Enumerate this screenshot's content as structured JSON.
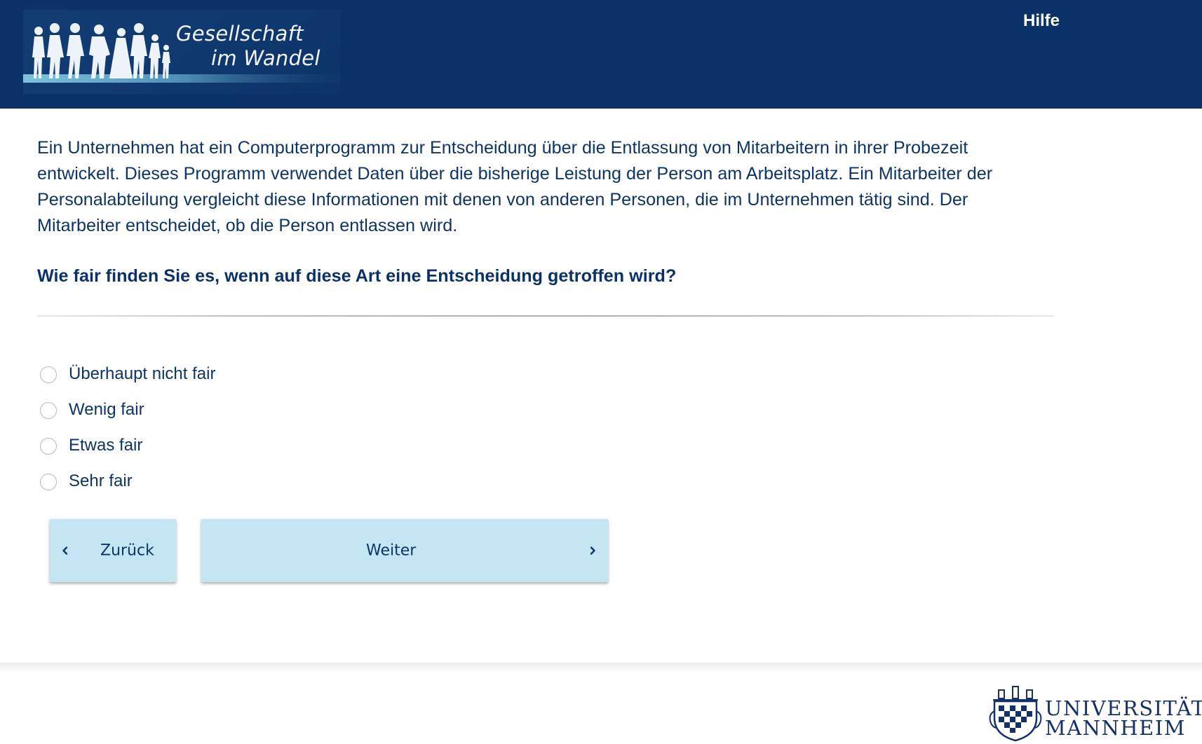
{
  "header": {
    "logo_line1": "Gesellschaft",
    "logo_line2": "im Wandel",
    "help_label": "Hilfe"
  },
  "main": {
    "intro_text": "Ein Unternehmen hat ein Computerprogramm zur Entscheidung über die Entlassung von Mitarbeitern in ihrer Probezeit entwickelt. Dieses Programm verwendet Daten über die bisherige Leistung der Person am Arbeitsplatz. Ein Mitarbeiter der Personalabteilung vergleicht diese Informationen mit denen von anderen Personen, die im Unternehmen tätig sind. Der Mitarbeiter entscheidet, ob die Person entlassen wird.",
    "question": "Wie fair finden Sie es, wenn auf diese Art eine Entscheidung getroffen wird?",
    "options": [
      {
        "label": "Überhaupt nicht fair",
        "selected": false
      },
      {
        "label": "Wenig fair",
        "selected": false
      },
      {
        "label": "Etwas fair",
        "selected": false
      },
      {
        "label": "Sehr fair",
        "selected": false
      }
    ]
  },
  "nav": {
    "back_label": "Zurück",
    "back_icon": "chevron-left-icon",
    "next_label": "Weiter",
    "next_icon": "chevron-right-icon"
  },
  "footer": {
    "logo_line1": "UNIVERSITÄT",
    "logo_line2": "MANNHEIM"
  },
  "colors": {
    "header_bg": "#0b3268",
    "text_primary": "#0c3467",
    "button_bg": "#c4e6f3",
    "page_bg": "#ffffff"
  }
}
